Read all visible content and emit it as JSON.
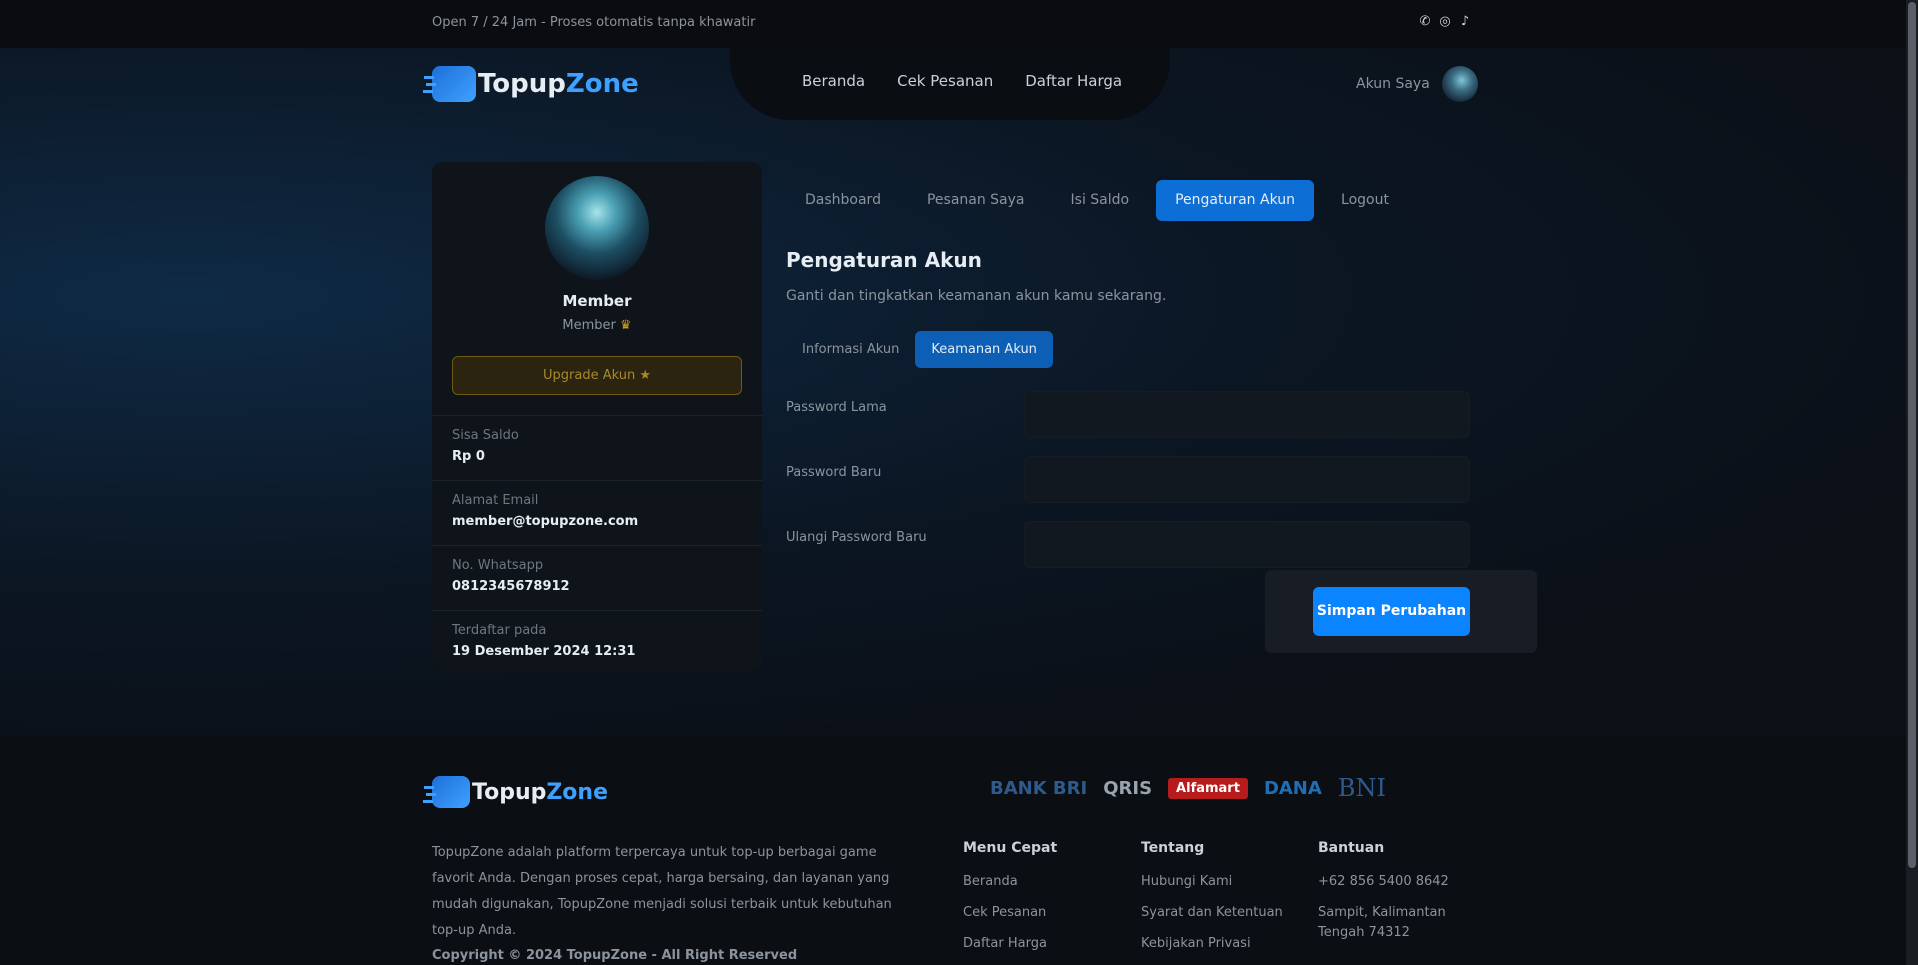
{
  "topbar": {
    "note": "Open 7 / 24 Jam - Proses otomatis tanpa khawatir",
    "social_icons": [
      "whatsapp-icon",
      "instagram-icon",
      "tiktok-icon"
    ]
  },
  "brand": {
    "part1": "Topup",
    "part2": "Zone"
  },
  "nav": {
    "home": "Beranda",
    "check_order": "Cek Pesanan",
    "price_list": "Daftar Harga"
  },
  "account": {
    "label": "Akun Saya"
  },
  "profile": {
    "name": "Member",
    "level": "Member",
    "upgrade_label": "Upgrade Akun",
    "upgrade_icon": "★",
    "info": [
      {
        "label": "Sisa Saldo",
        "value": "Rp 0"
      },
      {
        "label": "Alamat Email",
        "value": "member@topupzone.com"
      },
      {
        "label": "No. Whatsapp",
        "value": "0812345678912"
      },
      {
        "label": "Terdaftar pada",
        "value": "19 Desember 2024 12:31"
      }
    ]
  },
  "tabs": [
    "Dashboard",
    "Pesanan Saya",
    "Isi Saldo",
    "Pengaturan Akun",
    "Logout"
  ],
  "active_tab": "Pengaturan Akun",
  "page": {
    "title": "Pengaturan Akun",
    "subtitle": "Ganti dan tingkatkan keamanan akun kamu sekarang."
  },
  "subtabs": [
    "Informasi Akun",
    "Keamanan Akun"
  ],
  "active_subtab": "Keamanan Akun",
  "form": {
    "old_password": {
      "label": "Password Lama",
      "value": ""
    },
    "new_password": {
      "label": "Password Baru",
      "value": ""
    },
    "confirm_password": {
      "label": "Ulangi Password Baru",
      "value": ""
    },
    "save_label": "Simpan Perubahan"
  },
  "footer": {
    "payments": [
      "BANK BRI",
      "QRIS",
      "Alfamart",
      "DANA",
      "BNI"
    ],
    "about": "TopupZone adalah platform terpercaya untuk top-up berbagai game favorit Anda. Dengan proses cepat, harga bersaing, dan layanan yang mudah digunakan, TopupZone menjadi solusi terbaik untuk kebutuhan top-up Anda.",
    "copyright": "Copyright © 2024 TopupZone - All Right Reserved",
    "columns": [
      {
        "heading": "Menu Cepat",
        "items": [
          "Beranda",
          "Cek Pesanan",
          "Daftar Harga"
        ]
      },
      {
        "heading": "Tentang",
        "items": [
          "Hubungi Kami",
          "Syarat dan Ketentuan",
          "Kebijakan Privasi"
        ]
      },
      {
        "heading": "Bantuan",
        "items": [
          "+62 856 5400 8642",
          "Sampit, Kalimantan Tengah 74312"
        ]
      }
    ]
  },
  "colors": {
    "accent": "#0a84ff",
    "active_tab": "#0d6ed6",
    "background": "#0d1117"
  }
}
